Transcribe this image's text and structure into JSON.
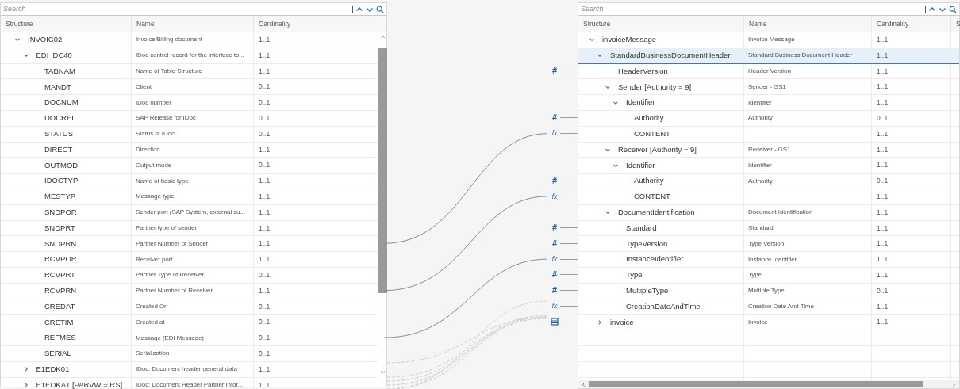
{
  "source": {
    "search": {
      "placeholder": "Search"
    },
    "columns": [
      "Structure",
      "Name",
      "Cardinality"
    ],
    "rows": [
      {
        "structure": "INVOIC02",
        "name": "Invoice/Billing document",
        "cardinality": "1..1",
        "expanded": true,
        "children": [
          {
            "structure": "EDI_DC40",
            "name": "IDoc control record for the interface to...",
            "cardinality": "1..1",
            "expanded": true,
            "children": [
              {
                "structure": "TABNAM",
                "name": "Name of Table Structure",
                "cardinality": "1..1"
              },
              {
                "structure": "MANDT",
                "name": "Client",
                "cardinality": "0..1"
              },
              {
                "structure": "DOCNUM",
                "name": "IDoc number",
                "cardinality": "0..1"
              },
              {
                "structure": "DOCREL",
                "name": "SAP Release for IDoc",
                "cardinality": "0..1"
              },
              {
                "structure": "STATUS",
                "name": "Status of IDoc",
                "cardinality": "0..1"
              },
              {
                "structure": "DIRECT",
                "name": "Direction",
                "cardinality": "1..1"
              },
              {
                "structure": "OUTMOD",
                "name": "Output mode",
                "cardinality": "0..1"
              },
              {
                "structure": "IDOCTYP",
                "name": "Name of basic type",
                "cardinality": "1..1"
              },
              {
                "structure": "MESTYP",
                "name": "Message type",
                "cardinality": "1..1"
              },
              {
                "structure": "SNDPOR",
                "name": "Sender port (SAP System, external su...",
                "cardinality": "1..1"
              },
              {
                "structure": "SNDPRT",
                "name": "Partner type of sender",
                "cardinality": "1..1"
              },
              {
                "structure": "SNDPRN",
                "name": "Partner Number of Sender",
                "cardinality": "1..1",
                "mapped": true
              },
              {
                "structure": "RCVPOR",
                "name": "Receiver port",
                "cardinality": "1..1"
              },
              {
                "structure": "RCVPRT",
                "name": "Partner Type of Receiver",
                "cardinality": "0..1"
              },
              {
                "structure": "RCVPRN",
                "name": "Partner Number of Receiver",
                "cardinality": "1..1",
                "mapped": true
              },
              {
                "structure": "CREDAT",
                "name": "Created On",
                "cardinality": "0..1"
              },
              {
                "structure": "CRETIM",
                "name": "Created at",
                "cardinality": "0..1"
              },
              {
                "structure": "REFMES",
                "name": "Message (EDI Message)",
                "cardinality": "0..1",
                "mapped": true
              },
              {
                "structure": "SERIAL",
                "name": "Serialization",
                "cardinality": "0..1"
              }
            ]
          },
          {
            "structure": "E1EDK01",
            "name": "IDoc: Document header general data",
            "cardinality": "1..1",
            "expanded": false
          },
          {
            "structure": "E1EDKA1 [PARVW = RS]",
            "name": "IDoc: Document Header Partner Infor...",
            "cardinality": "1..1",
            "expanded": false
          }
        ]
      }
    ]
  },
  "target": {
    "search": {
      "placeholder": "Search"
    },
    "columns": [
      "Structure",
      "Name",
      "Cardinality",
      "S"
    ],
    "rows": [
      {
        "structure": "invoiceMessage",
        "name": "Invoice Message",
        "cardinality": "1..1",
        "expanded": true,
        "selected": false,
        "children": [
          {
            "structure": "StandardBusinessDocumentHeader",
            "name": "Standard Business Document Header",
            "cardinality": "1..1",
            "expanded": true,
            "selected": true,
            "children": [
              {
                "structure": "HeaderVersion",
                "name": "Header Version",
                "cardinality": "1..1",
                "selected": false,
                "mapping": {
                  "kind": "symbol",
                  "symbol": "#"
                }
              },
              {
                "structure": "Sender [Authority = 9]",
                "name": "Sender - GS1",
                "cardinality": "1..1",
                "expanded": true,
                "selected": false,
                "children": [
                  {
                    "structure": "Identifier",
                    "name": "Identifier",
                    "cardinality": "1..1",
                    "expanded": true,
                    "selected": false,
                    "children": [
                      {
                        "structure": "Authority",
                        "name": "Authority",
                        "cardinality": "0..1",
                        "selected": false,
                        "mapping": {
                          "kind": "symbol",
                          "symbol": "#"
                        }
                      },
                      {
                        "structure": "CONTENT",
                        "cardinality": "1..1",
                        "selected": false,
                        "mapping": {
                          "kind": "function",
                          "symbol": "fx",
                          "connected": true
                        }
                      }
                    ]
                  }
                ]
              },
              {
                "structure": "Receiver [Authority = 9]",
                "name": "Receiver - GS1",
                "cardinality": "1..1",
                "expanded": true,
                "selected": false,
                "children": [
                  {
                    "structure": "Identifier",
                    "name": "Identifier",
                    "cardinality": "1..1",
                    "expanded": true,
                    "selected": false,
                    "children": [
                      {
                        "structure": "Authority",
                        "name": "Authority",
                        "cardinality": "0..1",
                        "selected": false,
                        "mapping": {
                          "kind": "symbol",
                          "symbol": "#"
                        }
                      },
                      {
                        "structure": "CONTENT",
                        "cardinality": "1..1",
                        "selected": false,
                        "mapping": {
                          "kind": "function",
                          "symbol": "fx",
                          "connected": true
                        }
                      }
                    ]
                  }
                ]
              },
              {
                "structure": "DocumentIdentification",
                "name": "Document Identification",
                "cardinality": "1..1",
                "expanded": true,
                "selected": false,
                "children": [
                  {
                    "structure": "Standard",
                    "name": "Standard",
                    "cardinality": "1..1",
                    "selected": false,
                    "mapping": {
                      "kind": "symbol",
                      "symbol": "#"
                    }
                  },
                  {
                    "structure": "TypeVersion",
                    "name": "Type Version",
                    "cardinality": "1..1",
                    "selected": false,
                    "mapping": {
                      "kind": "symbol",
                      "symbol": "#"
                    }
                  },
                  {
                    "structure": "InstanceIdentifier",
                    "name": "Instance Identifier",
                    "cardinality": "1..1",
                    "selected": false,
                    "mapping": {
                      "kind": "function",
                      "symbol": "fx",
                      "connected": true
                    }
                  },
                  {
                    "structure": "Type",
                    "name": "Type",
                    "cardinality": "1..1",
                    "selected": false,
                    "mapping": {
                      "kind": "symbol",
                      "symbol": "#"
                    }
                  },
                  {
                    "structure": "MultipleType",
                    "name": "Multiple Type",
                    "cardinality": "0..1",
                    "selected": false,
                    "mapping": {
                      "kind": "symbol",
                      "symbol": "#"
                    }
                  },
                  {
                    "structure": "CreationDateAndTime",
                    "name": "Creation Date And Time",
                    "cardinality": "1..1",
                    "selected": false,
                    "mapping": {
                      "kind": "function",
                      "symbol": "fx"
                    }
                  }
                ]
              }
            ]
          },
          {
            "structure": "invoice",
            "name": "Invoice",
            "cardinality": "1..1",
            "expanded": false,
            "selected": false,
            "mapping": {
              "kind": "table"
            }
          }
        ]
      }
    ]
  }
}
